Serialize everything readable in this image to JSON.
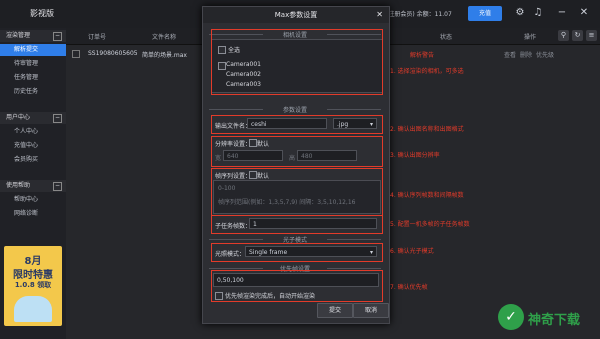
{
  "app": {
    "brand": "影视版"
  },
  "topbar": {
    "account_text": "(注册会员) 余额：11.07",
    "recharge_label": "充值",
    "icons": [
      "settings-gear-icon",
      "bell-icon",
      "minimize-icon",
      "close-icon"
    ]
  },
  "sidebar": {
    "groups": [
      {
        "label": "渲染管理",
        "toggle": "−",
        "items": [
          "解析提交",
          "待审管理",
          "任务管理",
          "历史任务"
        ]
      },
      {
        "label": "用户中心",
        "toggle": "−",
        "items": [
          "个人中心",
          "充值中心",
          "会员购买"
        ]
      },
      {
        "label": "使用帮助",
        "toggle": "−",
        "items": [
          "帮助中心",
          "网络诊断"
        ]
      }
    ],
    "active_item": "解析提交",
    "chips": [
      "客服",
      "吐槽"
    ],
    "promo": {
      "line1": "8月",
      "line2": "限时特惠",
      "line3": "1.0.8 领取"
    }
  },
  "table": {
    "headers": [
      "订单号",
      "文件名称",
      "状态",
      "操作"
    ],
    "row": {
      "order": "SS19080605605",
      "file": "简单的场景.max",
      "status": "解析警告",
      "actions": [
        "查看",
        "删除",
        "优先级"
      ]
    }
  },
  "dialog": {
    "title": "Max参数设置",
    "close_icon": "close-icon",
    "sections": {
      "camera": "相机设置",
      "params": "参数设置",
      "light": "光子模式",
      "priority": "优先帧设置"
    },
    "camera": {
      "select_all": "全选",
      "cameras": [
        "Camera001",
        "Camera002",
        "Camera003"
      ]
    },
    "output": {
      "label": "输出文件名：",
      "name": "ceshi",
      "ext": ".jpg"
    },
    "resolution": {
      "label": "分辨率设置：",
      "checkbox": "默认",
      "width_label": "宽",
      "width": "640",
      "height_label": "高",
      "height": "480"
    },
    "frames": {
      "label": "帧序列设置：",
      "checkbox": "默认",
      "line1": "0-100",
      "line2": "帧序列范围(例如：1,3,5,7,9) 间隔：3,5,10,12,16"
    },
    "subtask": {
      "label": "子任务帧数：",
      "value": "1"
    },
    "light": {
      "label": "光照模式：",
      "value": "Single frame"
    },
    "priority": {
      "value": "0,50,100",
      "note": "优先帧渲染完成后，自动开始渲染"
    },
    "buttons": {
      "submit": "提交",
      "cancel": "取消"
    }
  },
  "annotations": [
    "1. 选择渲染的相机，可多选",
    "2. 确认出图名称和出图格式",
    "3. 确认出图分辨率",
    "4. 确认序列帧数和间隔帧数",
    "5. 配置一机多帧的子任务帧数",
    "6. 确认光子模式",
    "7. 确认优先帧"
  ],
  "watermark": {
    "text": "神奇下载"
  },
  "colors": {
    "accent": "#2f7ee9",
    "annotation": "#e23b2a",
    "watermark": "#2fa04a",
    "promo": "#f3c84b"
  }
}
